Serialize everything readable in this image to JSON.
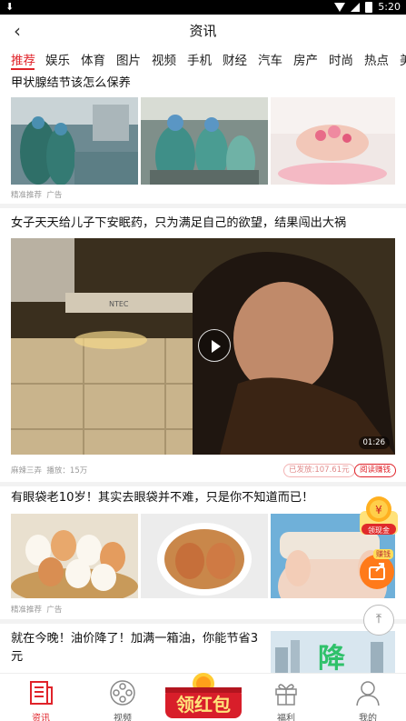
{
  "status": {
    "time": "5:20"
  },
  "header": {
    "title": "资讯",
    "back": "‹"
  },
  "tabs": [
    "推荐",
    "娱乐",
    "体育",
    "图片",
    "视频",
    "手机",
    "财经",
    "汽车",
    "房产",
    "时尚",
    "热点",
    "美"
  ],
  "active_tab": 0,
  "feed": [
    {
      "title": "甲状腺结节该怎么保养",
      "meta_source": "精准推荐",
      "meta_tag": "广告"
    },
    {
      "title": "女子天天给儿子下安眠药，只为满足自己的欲望，结果闯出大祸",
      "source": "麻辣三弄",
      "plays": "播放：15万",
      "duration": "01:26",
      "paid": "已发放:107.61元",
      "read_earn": "阅读赚钱",
      "watermark": "NTEC"
    },
    {
      "title": "有眼袋老10岁！其实去眼袋并不难，只是你不知道而已！",
      "meta_source": "精准推荐",
      "meta_tag": "广告"
    },
    {
      "title": "就在今晚！油价降了！加满一箱油，你能节省3元",
      "image_text": "降"
    }
  ],
  "floating": {
    "coin_label": "领现金",
    "coin_symbol": "¥",
    "share_tag": "赚钱",
    "top_icon": "⤒"
  },
  "bottomnav": {
    "items": [
      {
        "label": "资讯",
        "icon": "news-icon"
      },
      {
        "label": "视频",
        "icon": "film-reel-icon"
      },
      {
        "label": "福利",
        "icon": "gift-icon"
      },
      {
        "label": "我的",
        "icon": "person-icon"
      }
    ],
    "redpacket": "领红包"
  },
  "colors": {
    "accent": "#e0232a",
    "share": "#ff7a1a"
  }
}
